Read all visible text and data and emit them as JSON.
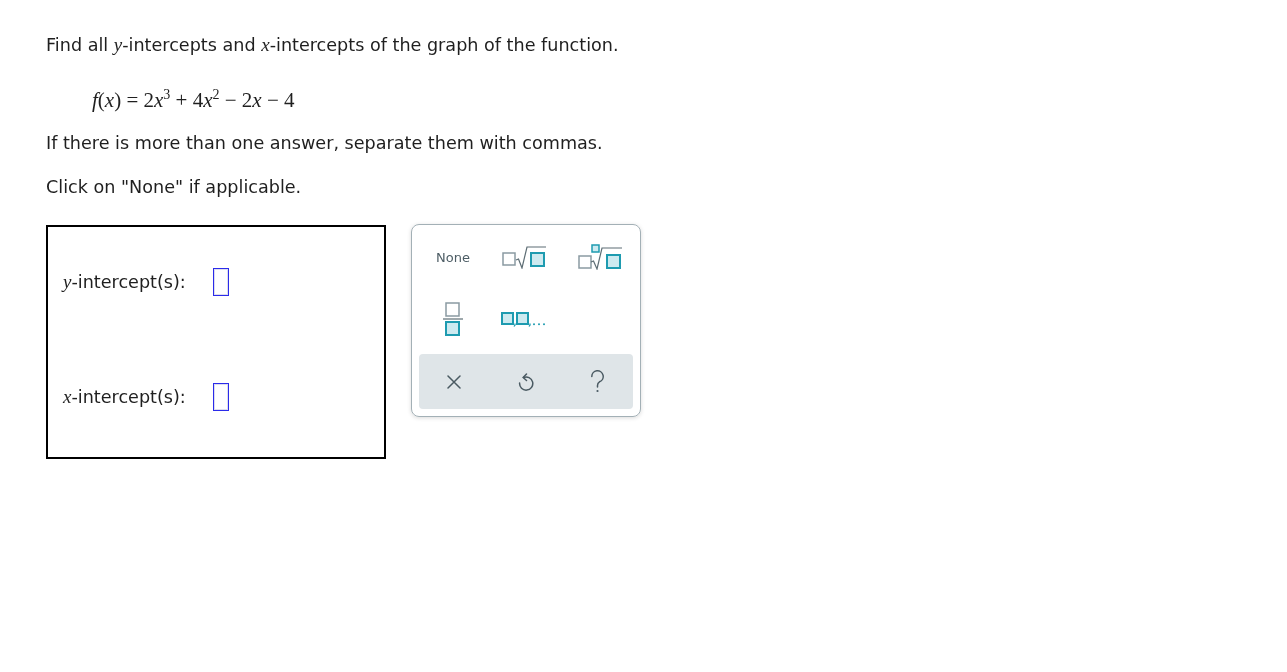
{
  "question": {
    "prompt": "Find all *y*-intercepts and *x*-intercepts of the graph of the function.",
    "function": [
      "*f*(*x*) = 2",
      "*x*$^{3}$",
      " + 4",
      "*x*$^{2}$",
      " − 2",
      "*x*",
      " − 4"
    ],
    "instructions": [
      "If there is more than one answer, separate them with commas.",
      "Click on \"None\" if applicable."
    ]
  },
  "answers": [
    {
      "label": "*y*-intercept(s):"
    },
    {
      "label": "*x*-intercept(s):"
    }
  ],
  "keypad": {
    "keys": [
      {
        "kind": "none",
        "label": "None"
      },
      {
        "kind": "sqrt"
      },
      {
        "kind": "nth-root"
      },
      {
        "kind": "fraction"
      },
      {
        "kind": "list"
      }
    ],
    "tools": [
      {
        "kind": "clear"
      },
      {
        "kind": "undo"
      },
      {
        "kind": "help"
      }
    ]
  }
}
